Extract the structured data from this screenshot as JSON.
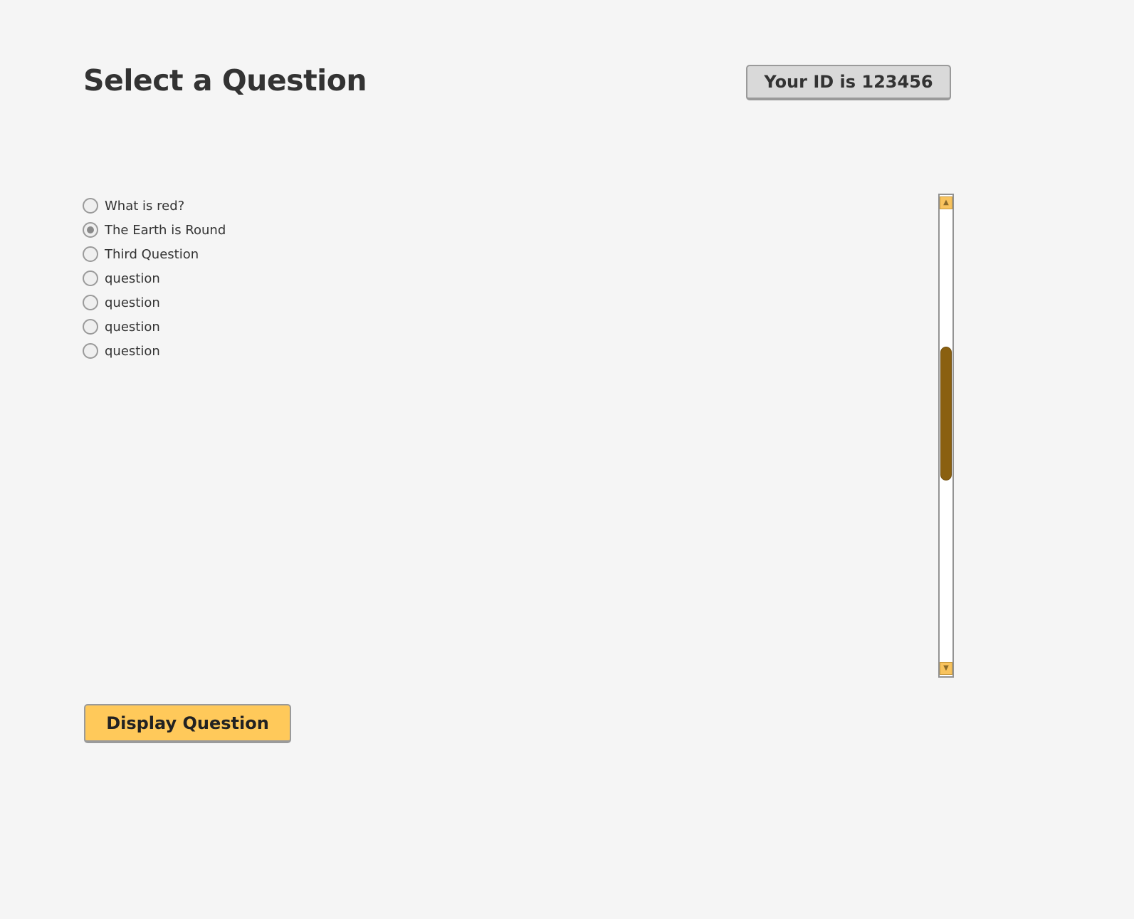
{
  "header": {
    "title": "Select a Question",
    "id_badge": "Your ID is 123456"
  },
  "questions": [
    {
      "label": "What is red?",
      "selected": false
    },
    {
      "label": "The Earth is Round",
      "selected": true
    },
    {
      "label": "Third Question",
      "selected": false
    },
    {
      "label": "question",
      "selected": false
    },
    {
      "label": "question",
      "selected": false
    },
    {
      "label": "question",
      "selected": false
    },
    {
      "label": "question",
      "selected": false
    }
  ],
  "scrollbar": {
    "up_icon": "arrow-up-icon",
    "down_icon": "arrow-down-icon"
  },
  "actions": {
    "display_label": "Display Question"
  },
  "colors": {
    "background": "#f5f5f5",
    "primary_button": "#ffc95a",
    "scroll_thumb": "#8a6010",
    "badge": "#d9d9d9",
    "text": "#333333"
  }
}
